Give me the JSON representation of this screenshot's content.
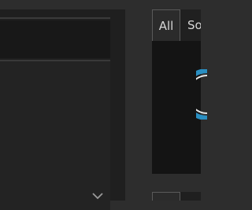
{
  "filter_tabs": [
    {
      "label": "All"
    },
    {
      "label": "So"
    }
  ],
  "icons": {
    "dropdown": "chevron-down-icon",
    "preview": "ring-icon"
  },
  "colors": {
    "accent": "#2a8fc2"
  }
}
